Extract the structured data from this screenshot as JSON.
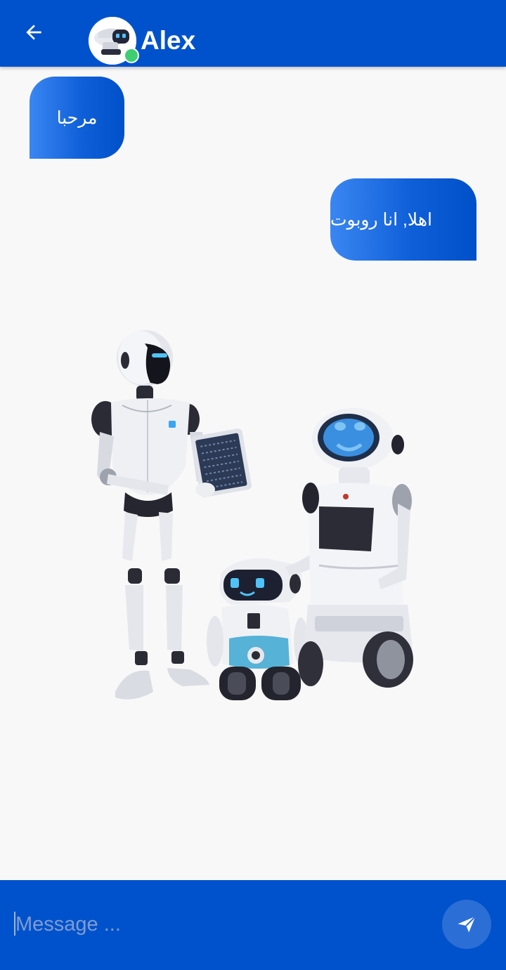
{
  "header": {
    "title": "Alex",
    "back_icon": "arrow-left-icon",
    "avatar": "robot-avatar",
    "status": "online",
    "background_color": "#0052cc"
  },
  "messages": [
    {
      "text": "مرحبا",
      "side": "left"
    },
    {
      "text": "اهلا, انا روبوت",
      "side": "right"
    }
  ],
  "illustration": "robots-illustration",
  "composer": {
    "placeholder": "Message ...",
    "value": "",
    "send_icon": "send-icon",
    "background_color": "#0052cc"
  }
}
